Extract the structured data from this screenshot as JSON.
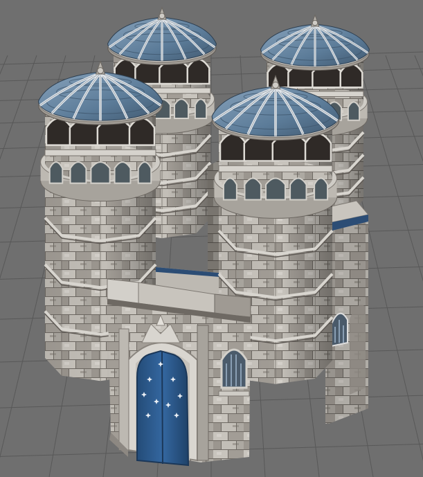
{
  "viewport": {
    "background": "#6f6f6f",
    "grid_line_color": "#585858",
    "grid_line_color_light": "#7a7a7a"
  },
  "model": {
    "subject": "castle",
    "stone_light": "#cfccc6",
    "stone_mid": "#a9a59e",
    "stone_dark": "#7d7872",
    "mortar": "#5a5550",
    "roof_blue": "#5f7f9c",
    "roof_dark": "#3e566d",
    "roof_rib": "#d7dde2",
    "trim_blue": "#2c4d75",
    "door_blue": "#2d5b8e",
    "door_dark": "#1b3758",
    "window_dark": "#3a3532"
  }
}
